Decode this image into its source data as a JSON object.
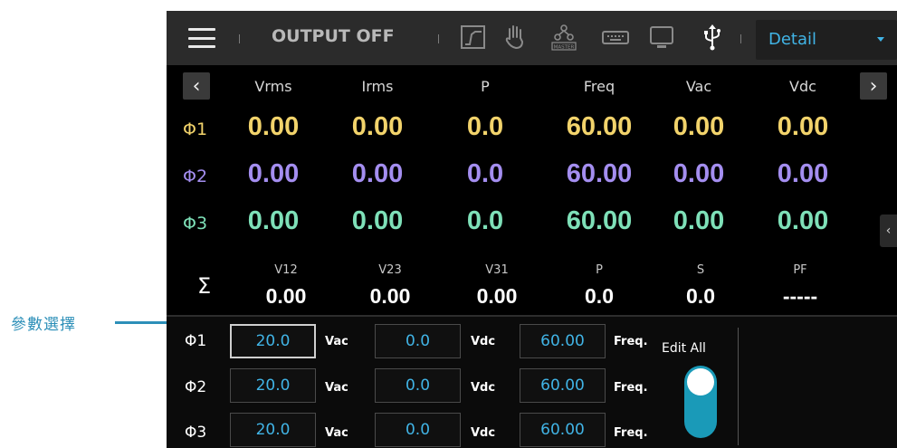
{
  "annotation": {
    "label": "參數選擇"
  },
  "topbar": {
    "menu_icon": "hamburger-menu-icon",
    "output_status": "OUTPUT OFF",
    "icons": [
      "waveform-icon",
      "hand-icon",
      "master-icon",
      "keyboard-icon",
      "monitor-icon",
      "usb-icon"
    ],
    "master_text": "MASTER",
    "usb_glyph": "⚲",
    "view_select": {
      "value": "Detail"
    }
  },
  "nav": {
    "prev": "‹",
    "next": "›"
  },
  "measure": {
    "headers": [
      "Vrms",
      "Irms",
      "P",
      "Freq",
      "Vac",
      "Vdc"
    ],
    "rows": [
      {
        "phase": "Φ1",
        "values": [
          "0.00",
          "0.00",
          "0.0",
          "60.00",
          "0.00",
          "0.00"
        ],
        "color": "#f2d36b"
      },
      {
        "phase": "Φ2",
        "values": [
          "0.00",
          "0.00",
          "0.0",
          "60.00",
          "0.00",
          "0.00"
        ],
        "color": "#a48ef0"
      },
      {
        "phase": "Φ3",
        "values": [
          "0.00",
          "0.00",
          "0.0",
          "60.00",
          "0.00",
          "0.00"
        ],
        "color": "#7ee0b8"
      }
    ]
  },
  "side_tab": {
    "glyph": "‹"
  },
  "summary": {
    "symbol": "Σ",
    "headers": [
      "V12",
      "V23",
      "V31",
      "P",
      "S",
      "PF"
    ],
    "values": [
      "0.00",
      "0.00",
      "0.00",
      "0.0",
      "0.0",
      "-----"
    ]
  },
  "settings": {
    "rows": [
      {
        "phase": "Φ1",
        "vac": "20.0",
        "vdc": "0.0",
        "freq": "60.00"
      },
      {
        "phase": "Φ2",
        "vac": "20.0",
        "vdc": "0.0",
        "freq": "60.00"
      },
      {
        "phase": "Φ3",
        "vac": "20.0",
        "vdc": "0.0",
        "freq": "60.00"
      }
    ],
    "units": {
      "vac": "Vac",
      "vdc": "Vdc",
      "freq": "Freq."
    },
    "edit_all": {
      "label": "Edit All",
      "on": true
    }
  }
}
